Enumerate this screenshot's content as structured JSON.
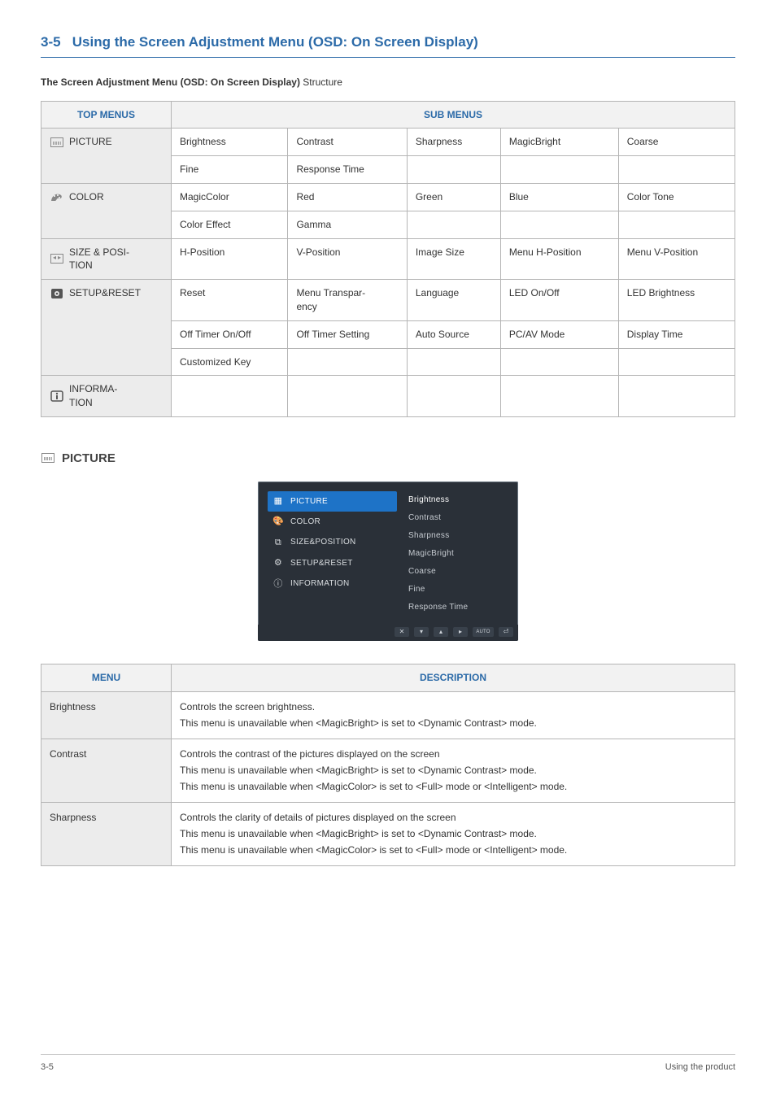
{
  "section": {
    "number": "3-5",
    "title": "Using the Screen Adjustment Menu (OSD: On Screen Display)"
  },
  "intro": {
    "bold": "The Screen Adjustment Menu (OSD: On Screen Display)",
    "rest": " Structure"
  },
  "structure_table": {
    "headers": {
      "top": "TOP MENUS",
      "sub": "SUB MENUS"
    },
    "rows": [
      {
        "menu": "PICTURE",
        "cells": [
          [
            "Brightness",
            "Contrast",
            "Sharpness",
            "MagicBright",
            "Coarse"
          ],
          [
            "Fine",
            "Response Time",
            "",
            "",
            ""
          ]
        ]
      },
      {
        "menu": "COLOR",
        "cells": [
          [
            "MagicColor",
            "Red",
            "Green",
            "Blue",
            "Color Tone"
          ],
          [
            "Color Effect",
            "Gamma",
            "",
            "",
            ""
          ]
        ]
      },
      {
        "menu": "SIZE & POSITION",
        "display": "SIZE & POSI-\nTION",
        "cells": [
          [
            "H-Position",
            "V-Position",
            "Image Size",
            "Menu H-Position",
            "Menu V-Position"
          ]
        ]
      },
      {
        "menu": "SETUP&RESET",
        "cells": [
          [
            "Reset",
            "Menu Transparency",
            "Language",
            "LED On/Off",
            "LED Brightness"
          ],
          [
            "Off Timer On/Off",
            "Off Timer Setting",
            "Auto Source",
            "PC/AV Mode",
            "Display Time"
          ],
          [
            "Customized Key",
            "",
            "",
            "",
            ""
          ]
        ]
      },
      {
        "menu": "INFORMATION",
        "display": "INFORMA-\nTION",
        "cells": [
          [
            "",
            "",
            "",
            "",
            ""
          ]
        ]
      }
    ]
  },
  "sub_heading": "PICTURE",
  "osd": {
    "left": [
      {
        "label": "PICTURE",
        "sel": true,
        "icon": "▦"
      },
      {
        "label": "COLOR",
        "icon": "🎨"
      },
      {
        "label": "SIZE&POSITION",
        "icon": "⧉"
      },
      {
        "label": "SETUP&RESET",
        "icon": "⚙"
      },
      {
        "label": "INFORMATION",
        "icon": "ⓘ"
      }
    ],
    "right": [
      "Brightness",
      "Contrast",
      "Sharpness",
      "MagicBright",
      "Coarse",
      "Fine",
      "Response Time"
    ],
    "footer_keys": [
      "✕",
      "▾",
      "▴",
      "▸",
      "AUTO",
      "⏎"
    ]
  },
  "desc_table": {
    "headers": {
      "menu": "MENU",
      "desc": "DESCRIPTION"
    },
    "rows": [
      {
        "menu": "Brightness",
        "lines": [
          "Controls the screen brightness.",
          "This menu is unavailable when <MagicBright> is set to <Dynamic Contrast> mode."
        ]
      },
      {
        "menu": "Contrast",
        "lines": [
          "Controls the contrast of the pictures displayed on the screen",
          "This menu is unavailable when <MagicBright> is set to <Dynamic Contrast> mode.",
          "This menu is unavailable when <MagicColor> is set to <Full> mode or <Intelligent> mode."
        ]
      },
      {
        "menu": "Sharpness",
        "lines": [
          "Controls the clarity of details of pictures displayed on the screen",
          "This menu is unavailable when <MagicBright> is set to <Dynamic Contrast> mode.",
          "This menu is unavailable when <MagicColor> is set to <Full> mode or <Intelligent> mode."
        ]
      }
    ]
  },
  "footer": {
    "left": "3-5",
    "right": "Using the product"
  }
}
